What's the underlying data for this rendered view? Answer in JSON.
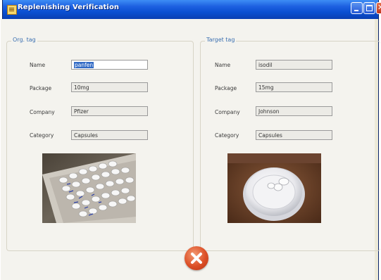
{
  "window": {
    "title": "Replenishing Verification"
  },
  "org_tag": {
    "legend": "Org. tag",
    "fields": [
      {
        "label": "Name",
        "value": "panfen"
      },
      {
        "label": "Package",
        "value": "10mg"
      },
      {
        "label": "Company",
        "value": "Pfizer"
      },
      {
        "label": "Category",
        "value": "Capsules"
      }
    ]
  },
  "target_tag": {
    "legend": "Target tag",
    "fields": [
      {
        "label": "Name",
        "value": "isodil"
      },
      {
        "label": "Package",
        "value": "15mg"
      },
      {
        "label": "Company",
        "value": "Johnson"
      },
      {
        "label": "Category",
        "value": "Capsules"
      }
    ]
  },
  "icons": {
    "app": "app-window-icon",
    "cancel": "cancel-x-icon"
  },
  "colors": {
    "titlebar": "#0a4fd1",
    "legend_text": "#3a6fb0",
    "cancel_button": "#dc4f26",
    "selection": "#316ac5"
  }
}
